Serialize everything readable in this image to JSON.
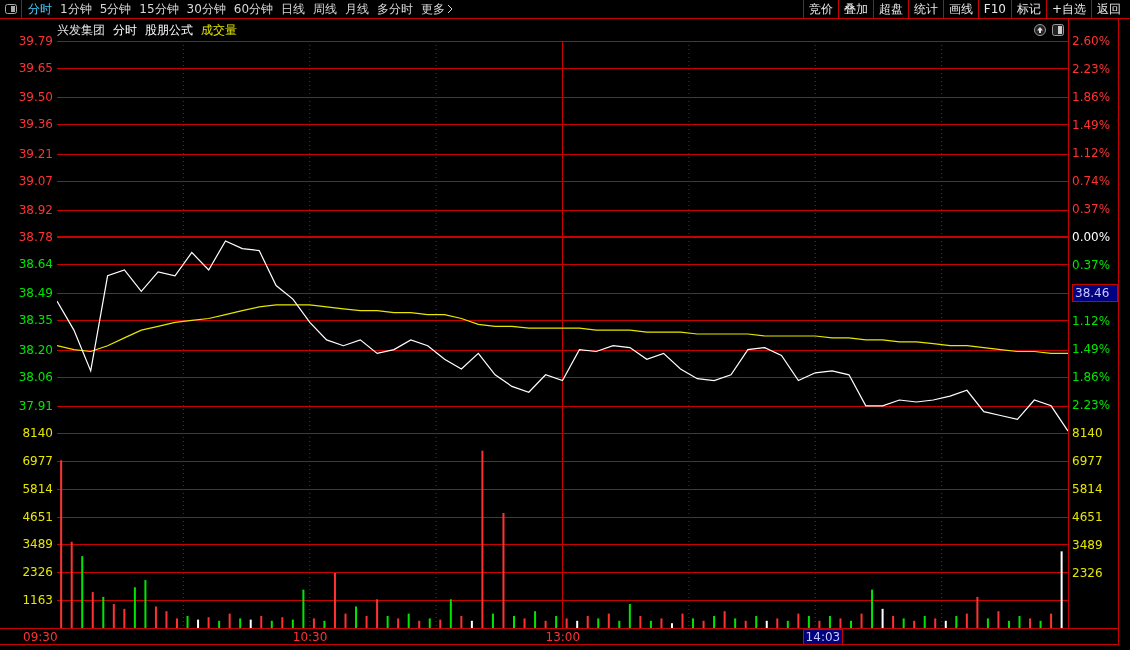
{
  "toolbar": {
    "tabs": [
      {
        "label": "分时",
        "selected": true
      },
      {
        "label": "1分钟",
        "selected": false
      },
      {
        "label": "5分钟",
        "selected": false
      },
      {
        "label": "15分钟",
        "selected": false
      },
      {
        "label": "30分钟",
        "selected": false
      },
      {
        "label": "60分钟",
        "selected": false
      },
      {
        "label": "日线",
        "selected": false
      },
      {
        "label": "周线",
        "selected": false
      },
      {
        "label": "月线",
        "selected": false
      },
      {
        "label": "多分时",
        "selected": false
      },
      {
        "label": "更多",
        "selected": false,
        "kind": "more"
      }
    ],
    "buttons": [
      "竞价",
      "叠加",
      "超盘",
      "统计",
      "画线",
      "F10",
      "标记",
      "+自选",
      "返回"
    ]
  },
  "header": {
    "stock": "兴发集团",
    "mode": "分时",
    "formula": "股朋公式",
    "indicator": "成交量"
  },
  "right_axis": {
    "price": [
      {
        "label": "2.60%",
        "color": "#ff3232",
        "kind": "tick"
      },
      {
        "label": "2.23%",
        "color": "#ff3232",
        "kind": "tick"
      },
      {
        "label": "1.86%",
        "color": "#ff3232",
        "kind": "tick"
      },
      {
        "label": "1.49%",
        "color": "#ff3232",
        "kind": "tick"
      },
      {
        "label": "1.12%",
        "color": "#ff3232",
        "kind": "tick"
      },
      {
        "label": "0.74%",
        "color": "#ff3232",
        "kind": "tick"
      },
      {
        "label": "0.37%",
        "color": "#ff3232",
        "kind": "tick"
      },
      {
        "label": "0.00%",
        "color": "#ffffff",
        "kind": "tick"
      },
      {
        "label": "0.37%",
        "color": "#00e600",
        "kind": "tick"
      },
      {
        "label": "38.46",
        "color": "#000080",
        "kind": "marker"
      },
      {
        "label": "1.12%",
        "color": "#00e600",
        "kind": "tick"
      },
      {
        "label": "1.49%",
        "color": "#00e600",
        "kind": "tick"
      },
      {
        "label": "1.86%",
        "color": "#00e600",
        "kind": "tick"
      },
      {
        "label": "2.23%",
        "color": "#00e600",
        "kind": "tick"
      }
    ],
    "volume": [
      "8140",
      "6977",
      "5814",
      "4651",
      "3489",
      "2326"
    ]
  },
  "price_chart": {
    "chart_data": {
      "type": "line",
      "grid": true,
      "categories": [
        null,
        null,
        null,
        null,
        null,
        null,
        null,
        null,
        null,
        null,
        null,
        null,
        null,
        null,
        null,
        null,
        null,
        null,
        null,
        null,
        null,
        null,
        null,
        null,
        null,
        null,
        null,
        null,
        null,
        null,
        null,
        null,
        null,
        null,
        null,
        null,
        null,
        null,
        null,
        null,
        null,
        null,
        null,
        null,
        null,
        null,
        null,
        null,
        null,
        null,
        null,
        null,
        null,
        null,
        null,
        null,
        null,
        null,
        null,
        null,
        null
      ],
      "ref_lines": [
        {
          "axis": "y",
          "value": 38.78
        }
      ],
      "ylim": [
        37.77,
        39.79
      ],
      "yticks": [
        {
          "value": 39.79,
          "label": "39.79"
        },
        {
          "value": 39.65,
          "label": "39.65"
        },
        {
          "value": 39.5,
          "label": "39.50"
        },
        {
          "value": 39.36,
          "label": "39.36"
        },
        {
          "value": 39.21,
          "label": "39.21"
        },
        {
          "value": 39.07,
          "label": "39.07"
        },
        {
          "value": 38.92,
          "label": "38.92"
        },
        {
          "value": 38.78,
          "label": "38.78"
        },
        {
          "value": 38.64,
          "label": "38.64"
        },
        {
          "value": 38.49,
          "label": "38.49"
        },
        {
          "value": 38.35,
          "label": "38.35"
        },
        {
          "value": 38.2,
          "label": "38.20"
        },
        {
          "value": 38.06,
          "label": "38.06"
        },
        {
          "value": 37.91,
          "label": "37.91"
        }
      ],
      "series": [
        {
          "color": "#ffffff",
          "values": [
            38.45,
            38.3,
            38.09,
            38.58,
            38.61,
            38.5,
            38.6,
            38.58,
            38.7,
            38.61,
            38.76,
            38.72,
            38.71,
            38.53,
            38.46,
            38.34,
            38.25,
            38.22,
            38.25,
            38.18,
            38.2,
            38.25,
            38.22,
            38.15,
            38.1,
            38.18,
            38.07,
            38.01,
            37.98,
            38.07,
            38.04,
            38.2,
            38.19,
            38.22,
            38.21,
            38.15,
            38.18,
            38.1,
            38.05,
            38.04,
            38.07,
            38.2,
            38.21,
            38.17,
            38.04,
            38.08,
            38.09,
            38.07,
            37.91,
            37.91,
            37.94,
            37.93,
            37.94,
            37.96,
            37.99,
            37.88,
            37.86,
            37.84,
            37.94,
            37.91,
            37.78
          ]
        },
        {
          "color": "#e6e600",
          "values": [
            38.22,
            38.2,
            38.19,
            38.22,
            38.26,
            38.3,
            38.32,
            38.34,
            38.35,
            38.36,
            38.38,
            38.4,
            38.42,
            38.43,
            38.43,
            38.43,
            38.42,
            38.41,
            38.4,
            38.4,
            38.39,
            38.39,
            38.38,
            38.38,
            38.36,
            38.33,
            38.32,
            38.32,
            38.31,
            38.31,
            38.31,
            38.31,
            38.3,
            38.3,
            38.3,
            38.29,
            38.29,
            38.29,
            38.28,
            38.28,
            38.28,
            38.28,
            38.27,
            38.27,
            38.27,
            38.27,
            38.26,
            38.26,
            38.25,
            38.25,
            38.24,
            38.24,
            38.23,
            38.22,
            38.22,
            38.21,
            38.2,
            38.19,
            38.19,
            38.18,
            38.18
          ]
        }
      ]
    }
  },
  "volume_chart": {
    "chart_data": {
      "type": "bar",
      "grid": true,
      "ylim": [
        0,
        8140
      ],
      "yticks": [
        {
          "value": 8140,
          "label": "8140"
        },
        {
          "value": 6977,
          "label": "6977"
        },
        {
          "value": 5814,
          "label": "5814"
        },
        {
          "value": 4651,
          "label": "4651"
        },
        {
          "value": 3489,
          "label": "3489"
        },
        {
          "value": 2326,
          "label": "2326"
        },
        {
          "value": 1163,
          "label": "1163"
        }
      ],
      "categories": [
        null,
        null,
        null,
        null,
        null,
        null,
        null,
        null,
        null,
        null,
        null,
        null,
        null,
        null,
        null,
        null,
        null,
        null,
        null,
        null,
        null,
        null,
        null,
        null,
        null,
        null,
        null,
        null,
        null,
        null,
        null,
        null,
        null,
        null,
        null,
        null,
        null,
        null,
        null,
        null,
        null,
        null,
        null,
        null,
        null,
        null,
        null,
        null,
        null,
        null,
        null,
        null,
        null,
        null,
        null,
        null,
        null,
        null,
        null,
        null,
        null,
        null,
        null,
        null,
        null,
        null,
        null,
        null,
        null,
        null,
        null,
        null,
        null,
        null,
        null,
        null,
        null,
        null,
        null,
        null,
        null,
        null,
        null,
        null,
        null,
        null,
        null,
        null,
        null,
        null,
        null,
        null,
        null,
        null,
        null,
        null
      ],
      "series": [
        {
          "color": "#ff3232",
          "values": [
            7000,
            3600,
            null,
            1500,
            null,
            1000,
            800,
            null,
            null,
            900,
            700,
            400,
            null,
            null,
            450,
            null,
            600,
            null,
            null,
            500,
            null,
            450,
            null,
            null,
            400,
            null,
            2300,
            600,
            null,
            500,
            1200,
            null,
            400,
            null,
            300,
            null,
            350,
            null,
            500,
            null,
            7400,
            null,
            4800,
            null,
            400,
            null,
            300,
            null,
            400,
            null,
            500,
            null,
            600,
            null,
            null,
            500,
            null,
            400,
            null,
            600,
            null,
            300,
            null,
            700,
            null,
            300,
            null,
            null,
            400,
            null,
            600,
            null,
            300,
            null,
            400,
            null,
            600,
            null,
            null,
            500,
            null,
            300,
            null,
            400,
            null,
            null,
            600,
            1300,
            null,
            700,
            null,
            null,
            400,
            null,
            600,
            null
          ]
        },
        {
          "color": "#00e600",
          "values": [
            null,
            null,
            3000,
            null,
            1300,
            null,
            null,
            1700,
            2000,
            null,
            null,
            null,
            500,
            null,
            null,
            300,
            null,
            400,
            null,
            null,
            300,
            null,
            350,
            1600,
            null,
            300,
            null,
            null,
            900,
            null,
            null,
            500,
            null,
            600,
            null,
            400,
            null,
            1200,
            null,
            null,
            null,
            600,
            null,
            500,
            null,
            700,
            null,
            500,
            null,
            null,
            null,
            400,
            null,
            300,
            1000,
            null,
            300,
            null,
            null,
            null,
            400,
            null,
            500,
            null,
            400,
            null,
            500,
            null,
            null,
            300,
            null,
            500,
            null,
            500,
            null,
            300,
            null,
            1600,
            null,
            null,
            400,
            null,
            500,
            null,
            null,
            500,
            null,
            null,
            400,
            null,
            300,
            500,
            null,
            300,
            null,
            null
          ]
        },
        {
          "color": "#ffffff",
          "values": [
            null,
            null,
            null,
            null,
            null,
            null,
            null,
            null,
            null,
            null,
            null,
            null,
            null,
            350,
            null,
            null,
            null,
            null,
            350,
            null,
            null,
            null,
            null,
            null,
            null,
            null,
            null,
            null,
            null,
            null,
            null,
            null,
            null,
            null,
            null,
            null,
            null,
            null,
            null,
            300,
            null,
            null,
            null,
            null,
            null,
            null,
            null,
            null,
            null,
            300,
            null,
            null,
            null,
            null,
            null,
            null,
            null,
            null,
            200,
            null,
            null,
            null,
            null,
            null,
            null,
            null,
            null,
            300,
            null,
            null,
            null,
            null,
            null,
            null,
            null,
            null,
            null,
            null,
            800,
            null,
            null,
            null,
            null,
            null,
            300,
            null,
            null,
            null,
            null,
            null,
            null,
            null,
            null,
            null,
            null,
            3200
          ]
        }
      ]
    }
  },
  "time_axis": [
    "09:30",
    "10:30",
    "13:00"
  ],
  "cursor_time": "14:03"
}
